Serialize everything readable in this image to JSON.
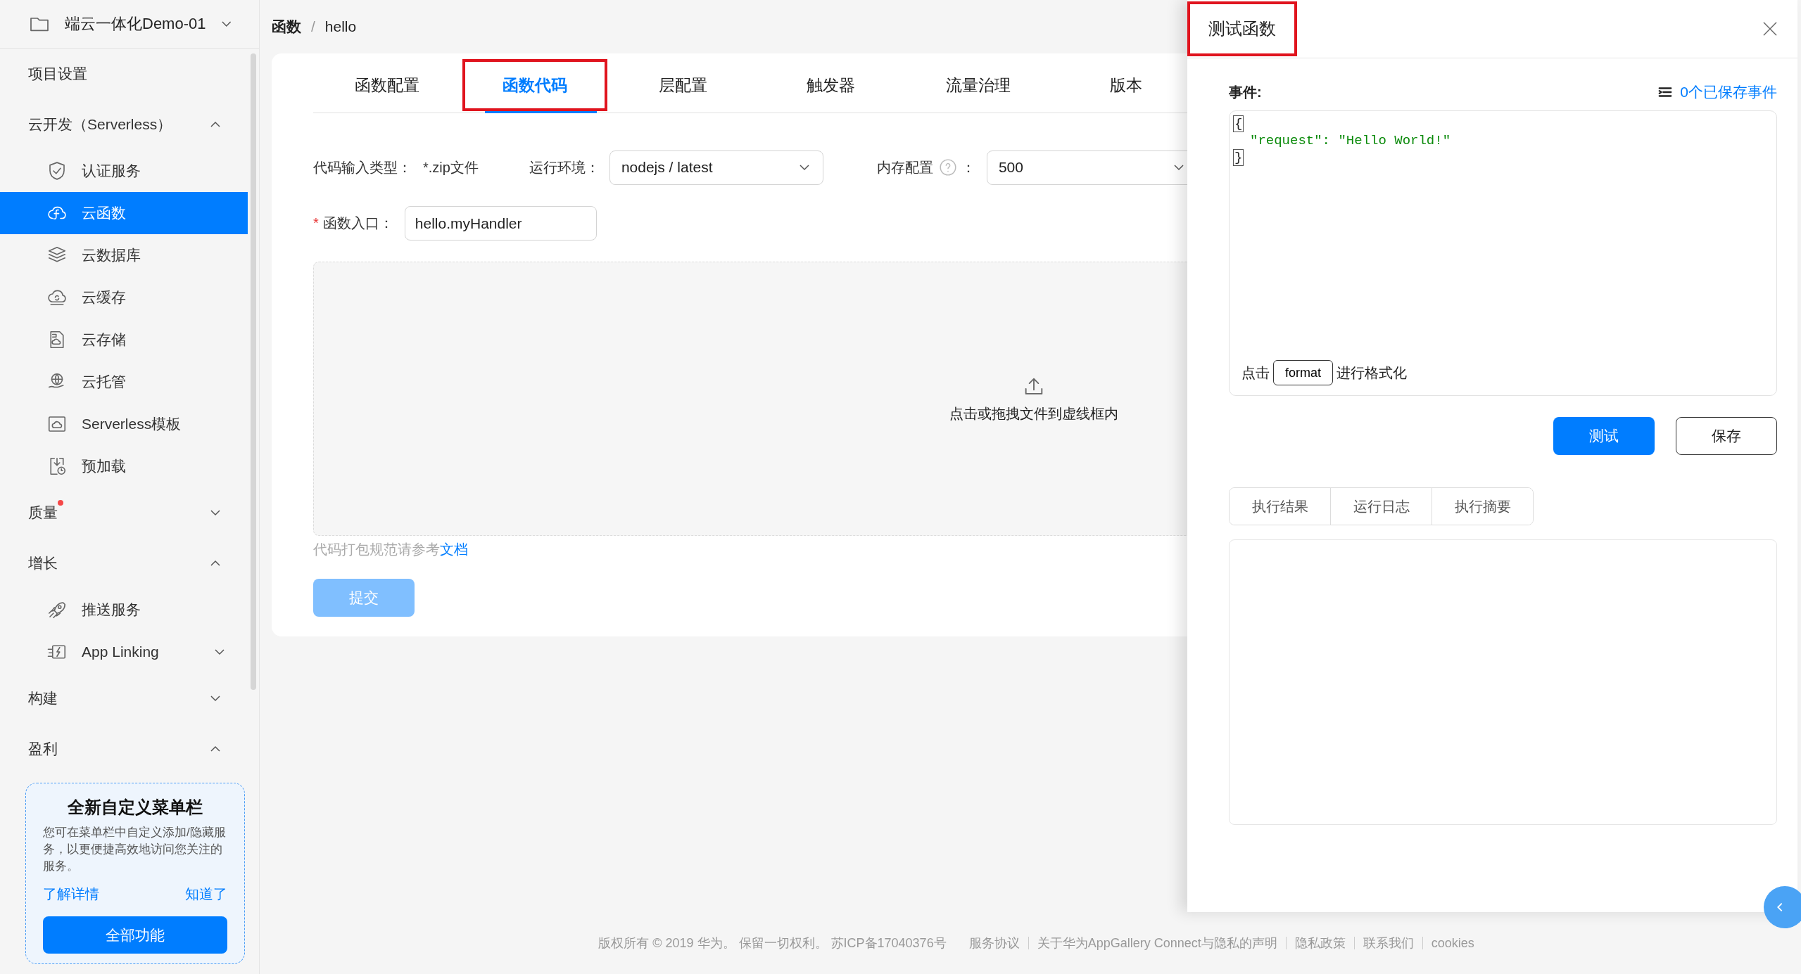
{
  "project": {
    "name": "端云一体化Demo-01"
  },
  "sidebar": {
    "items": [
      {
        "kind": "link",
        "label": "项目设置",
        "has_notification": false
      },
      {
        "kind": "group",
        "label": "云开发（Serverless）",
        "expanded": true,
        "has_notification": false,
        "children": [
          {
            "label": "认证服务",
            "selected": false,
            "has_submenu": false
          },
          {
            "label": "云函数",
            "selected": true,
            "has_submenu": false
          },
          {
            "label": "云数据库",
            "selected": false,
            "has_submenu": false
          },
          {
            "label": "云缓存",
            "selected": false,
            "has_submenu": false
          },
          {
            "label": "云存储",
            "selected": false,
            "has_submenu": false
          },
          {
            "label": "云托管",
            "selected": false,
            "has_submenu": false
          },
          {
            "label": "Serverless模板",
            "selected": false,
            "has_submenu": false
          },
          {
            "label": "预加载",
            "selected": false,
            "has_submenu": false
          }
        ]
      },
      {
        "kind": "group",
        "label": "质量",
        "expanded": false,
        "has_notification": true
      },
      {
        "kind": "group",
        "label": "增长",
        "expanded": true,
        "has_notification": false,
        "children": [
          {
            "label": "推送服务",
            "selected": false,
            "has_submenu": false
          },
          {
            "label": "App Linking",
            "selected": false,
            "has_submenu": true
          }
        ]
      },
      {
        "kind": "group",
        "label": "构建",
        "expanded": false,
        "has_notification": false
      },
      {
        "kind": "group",
        "label": "盈利",
        "expanded": true,
        "has_notification": false
      }
    ],
    "promo": {
      "title": "全新自定义菜单栏",
      "text": "您可在菜单栏中自定义添加/隐藏服务，以更便捷高效地访问您关注的服务。",
      "links": [
        "了解详情",
        "知道了"
      ],
      "button": "全部功能"
    }
  },
  "main": {
    "breadcrumb": [
      "函数",
      "hello"
    ],
    "breadcrumb_separator": "/",
    "tabs": [
      {
        "label": "函数配置",
        "selected": false,
        "highlighted": false
      },
      {
        "label": "函数代码",
        "selected": true,
        "highlighted": true
      },
      {
        "label": "层配置",
        "selected": false,
        "highlighted": false
      },
      {
        "label": "触发器",
        "selected": false,
        "highlighted": false
      },
      {
        "label": "流量治理",
        "selected": false,
        "highlighted": false
      },
      {
        "label": "版本",
        "selected": false,
        "highlighted": false
      }
    ],
    "code_type": {
      "label": "代码输入类型：",
      "value": "*.zip文件"
    },
    "runtime": {
      "label": "运行环境：",
      "value": "nodejs / latest"
    },
    "memory": {
      "label": "内存配置",
      "colon": "：",
      "value": "500"
    },
    "entry": {
      "label": "函数入口：",
      "value": "hello.myHandler",
      "required_mark": "*"
    },
    "upload": {
      "text": "点击或拖拽文件到虚线框内"
    },
    "hint": {
      "text": "代码打包规范请参考",
      "link": "文档"
    },
    "submit": {
      "label": "提交",
      "disabled": true
    }
  },
  "drawer": {
    "title": "测试函数",
    "title_highlighted": true,
    "event_label": "事件:",
    "saved_events": "0个已保存事件",
    "code_lines": [
      "{",
      "\"request\": \"Hello World!\"",
      "}"
    ],
    "format_hint": {
      "prefix": "点击",
      "button": "format",
      "suffix": "进行格式化"
    },
    "buttons": [
      {
        "label": "测试",
        "kind": "primary"
      },
      {
        "label": "保存",
        "kind": "secondary"
      }
    ],
    "result_tabs": [
      {
        "label": "执行结果",
        "selected": false
      },
      {
        "label": "运行日志",
        "selected": false
      },
      {
        "label": "执行摘要",
        "selected": false
      }
    ]
  },
  "footer": {
    "copyright": "版权所有 © 2019 华为。 保留一切权利。 苏ICP备17040376号",
    "links": [
      "服务协议",
      "关于华为AppGallery Connect与隐私的声明",
      "隐私政策",
      "联系我们",
      "cookies"
    ]
  }
}
